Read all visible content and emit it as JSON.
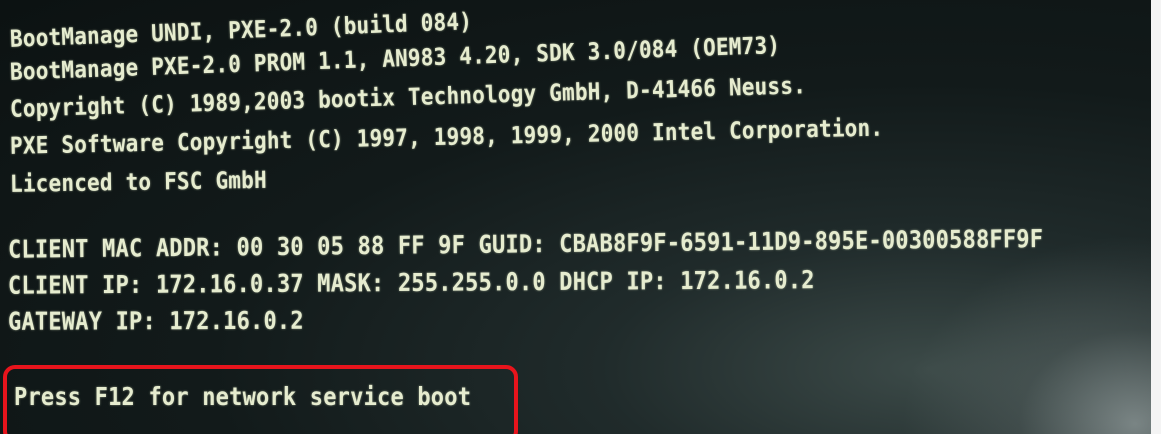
{
  "boot_screen": {
    "lines": [
      "BootManage UNDI, PXE-2.0 (build 084)",
      "BootManage PXE-2.0 PROM 1.1, AN983 4.20, SDK 3.0/084 (OEM73)",
      "Copyright (C) 1989,2003 bootix Technology GmbH, D-41466 Neuss.",
      "PXE Software Copyright (C) 1997, 1998, 1999, 2000 Intel Corporation.",
      "Licenced to FSC GmbH",
      "CLIENT MAC ADDR: 00 30 05 88 FF 9F  GUID: CBAB8F9F-6591-11D9-895E-00300588FF9F",
      "CLIENT IP: 172.16.0.37  MASK: 255.255.0.0  DHCP IP: 172.16.0.2",
      "GATEWAY IP: 172.16.0.2"
    ],
    "prompt": "Press F12 for network service boot"
  },
  "colors": {
    "text": "#e6eccf",
    "background": "#121a1a",
    "highlight_border": "#e8141c"
  }
}
